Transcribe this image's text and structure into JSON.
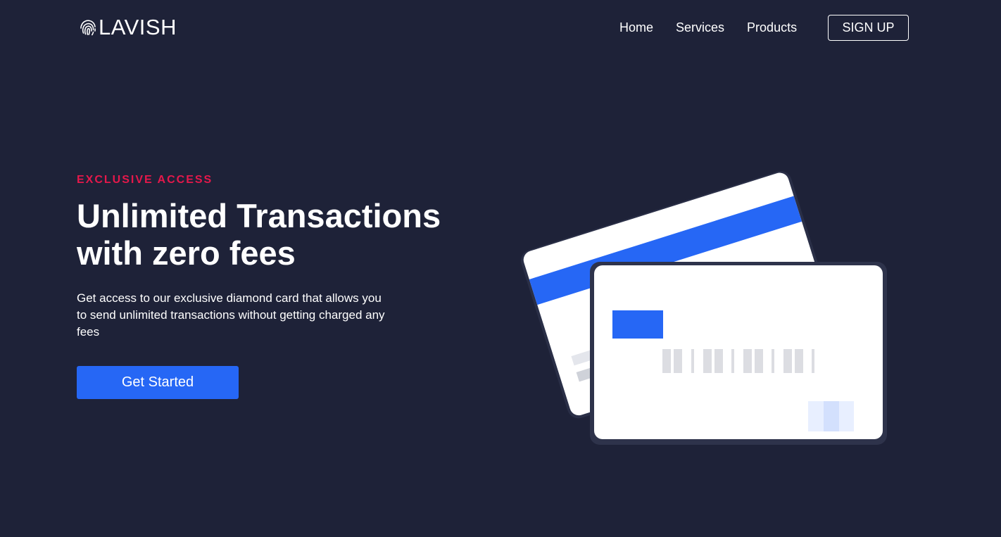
{
  "brand": {
    "name": "LAVISH",
    "icon": "fingerprint-icon"
  },
  "nav": {
    "links": [
      {
        "label": "Home"
      },
      {
        "label": "Services"
      },
      {
        "label": "Products"
      }
    ],
    "signup_label": "SIGN UP"
  },
  "hero": {
    "eyebrow": "EXCLUSIVE ACCESS",
    "headline_line1": "Unlimited Transactions",
    "headline_line2": "with zero fees",
    "description": "Get access to our exclusive diamond card that allows you to send unlimited transactions without getting charged any fees",
    "cta_label": "Get Started"
  },
  "colors": {
    "background": "#1e2238",
    "accent": "#2667f5",
    "eyebrow": "#e5184b",
    "card": "#ffffff"
  }
}
